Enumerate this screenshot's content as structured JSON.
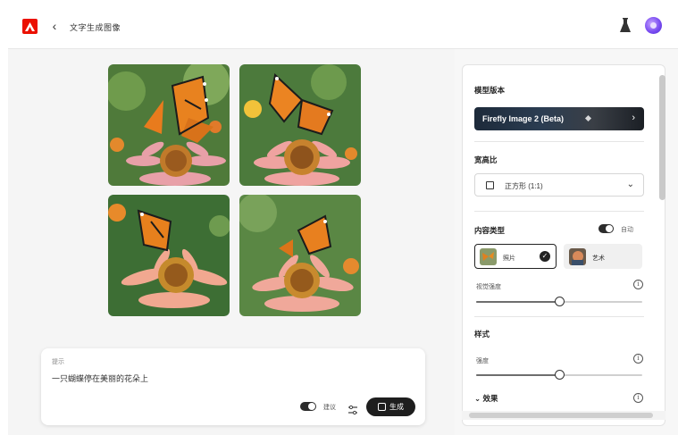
{
  "header": {
    "title": "文字生成图像",
    "back_icon": "chevron-left-icon",
    "flask_icon": "flask-icon",
    "avatar_icon": "user-avatar"
  },
  "images": [
    {
      "alt": "butterfly-on-coneflower-1"
    },
    {
      "alt": "butterfly-on-coneflower-2"
    },
    {
      "alt": "butterfly-on-coneflower-3"
    },
    {
      "alt": "butterfly-on-coneflower-4"
    }
  ],
  "prompt": {
    "label": "提示",
    "text": "一只蝴蝶停在美丽的花朵上",
    "toggle_label": "建议",
    "generate_label": "生成"
  },
  "panel": {
    "model_section_title": "模型版本",
    "model_name": "Firefly Image 2 (Beta)",
    "aspect_section_title": "宽高比",
    "aspect_value": "正方形 (1:1)",
    "content_section_title": "内容类型",
    "auto_label": "自动",
    "content_types": [
      {
        "label": "照片",
        "selected": true
      },
      {
        "label": "艺术",
        "selected": false
      }
    ],
    "visual_intensity_label": "视觉强度",
    "visual_intensity_value": 0.5,
    "style_section_title": "样式",
    "strength_label": "强度",
    "strength_value": 0.5,
    "effects_label": "效果"
  },
  "colors": {
    "brand_red": "#eb1000",
    "dark_button": "#1e1e1e"
  }
}
